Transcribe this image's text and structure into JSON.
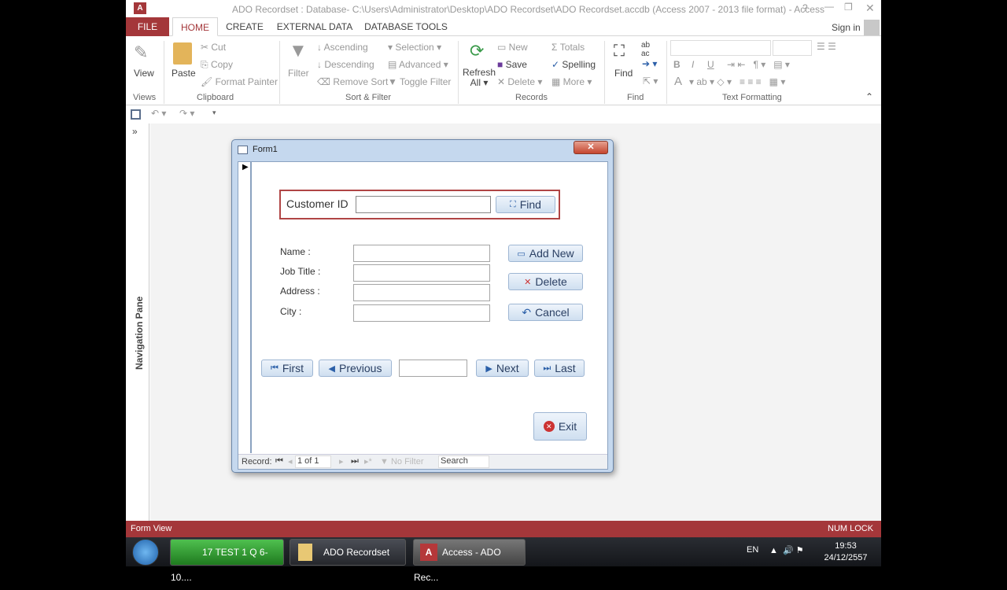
{
  "window": {
    "title": "ADO Recordset : Database- C:\\Users\\Administrator\\Desktop\\ADO Recordset\\ADO Recordset.accdb (Access 2007 - 2013 file format) - Access",
    "sign_in": "Sign in"
  },
  "tabs": [
    "FILE",
    "HOME",
    "CREATE",
    "EXTERNAL DATA",
    "DATABASE TOOLS"
  ],
  "ribbon": {
    "views": {
      "view": "View",
      "group": "Views"
    },
    "clipboard": {
      "paste": "Paste",
      "cut": "Cut",
      "copy": "Copy",
      "format_painter": "Format Painter",
      "group": "Clipboard"
    },
    "sort_filter": {
      "filter": "Filter",
      "ascending": "Ascending",
      "descending": "Descending",
      "remove_sort": "Remove Sort",
      "selection": "Selection",
      "advanced": "Advanced",
      "toggle_filter": "Toggle Filter",
      "group": "Sort & Filter"
    },
    "records": {
      "refresh": "Refresh",
      "refresh2": "All",
      "new": "New",
      "save": "Save",
      "delete": "Delete",
      "totals": "Totals",
      "spelling": "Spelling",
      "more": "More",
      "group": "Records"
    },
    "find": {
      "find": "Find",
      "group": "Find"
    },
    "text_formatting": {
      "bold": "B",
      "italic": "I",
      "underline": "U",
      "font_color": "A",
      "group": "Text Formatting"
    }
  },
  "nav_pane": {
    "label": "Navigation Pane",
    "toggle": "»"
  },
  "form": {
    "title": "Form1",
    "customer_id_label": "Customer ID",
    "customer_id_value": "",
    "find_button": "Find",
    "fields": [
      {
        "label": "Name :",
        "value": ""
      },
      {
        "label": "Job Title :",
        "value": ""
      },
      {
        "label": "Address :",
        "value": ""
      },
      {
        "label": "City :",
        "value": ""
      }
    ],
    "add_new": "Add New",
    "delete": "Delete",
    "cancel": "Cancel",
    "first": "First",
    "previous": "Previous",
    "position_value": "",
    "next": "Next",
    "last": "Last",
    "exit": "Exit",
    "record_nav": {
      "label": "Record:",
      "current": "1 of 1",
      "no_filter": "No Filter",
      "search": "Search"
    }
  },
  "status": {
    "left": "Form View",
    "right": "NUM LOCK"
  },
  "taskbar": {
    "items": [
      "17 TEST 1 Q 6-10....",
      "ADO Recordset",
      "Access - ADO Rec..."
    ],
    "lang": "EN",
    "time": "19:53",
    "date": "24/12/2557"
  },
  "colors": {
    "accent": "#a4373a",
    "form_border": "#b04545"
  }
}
